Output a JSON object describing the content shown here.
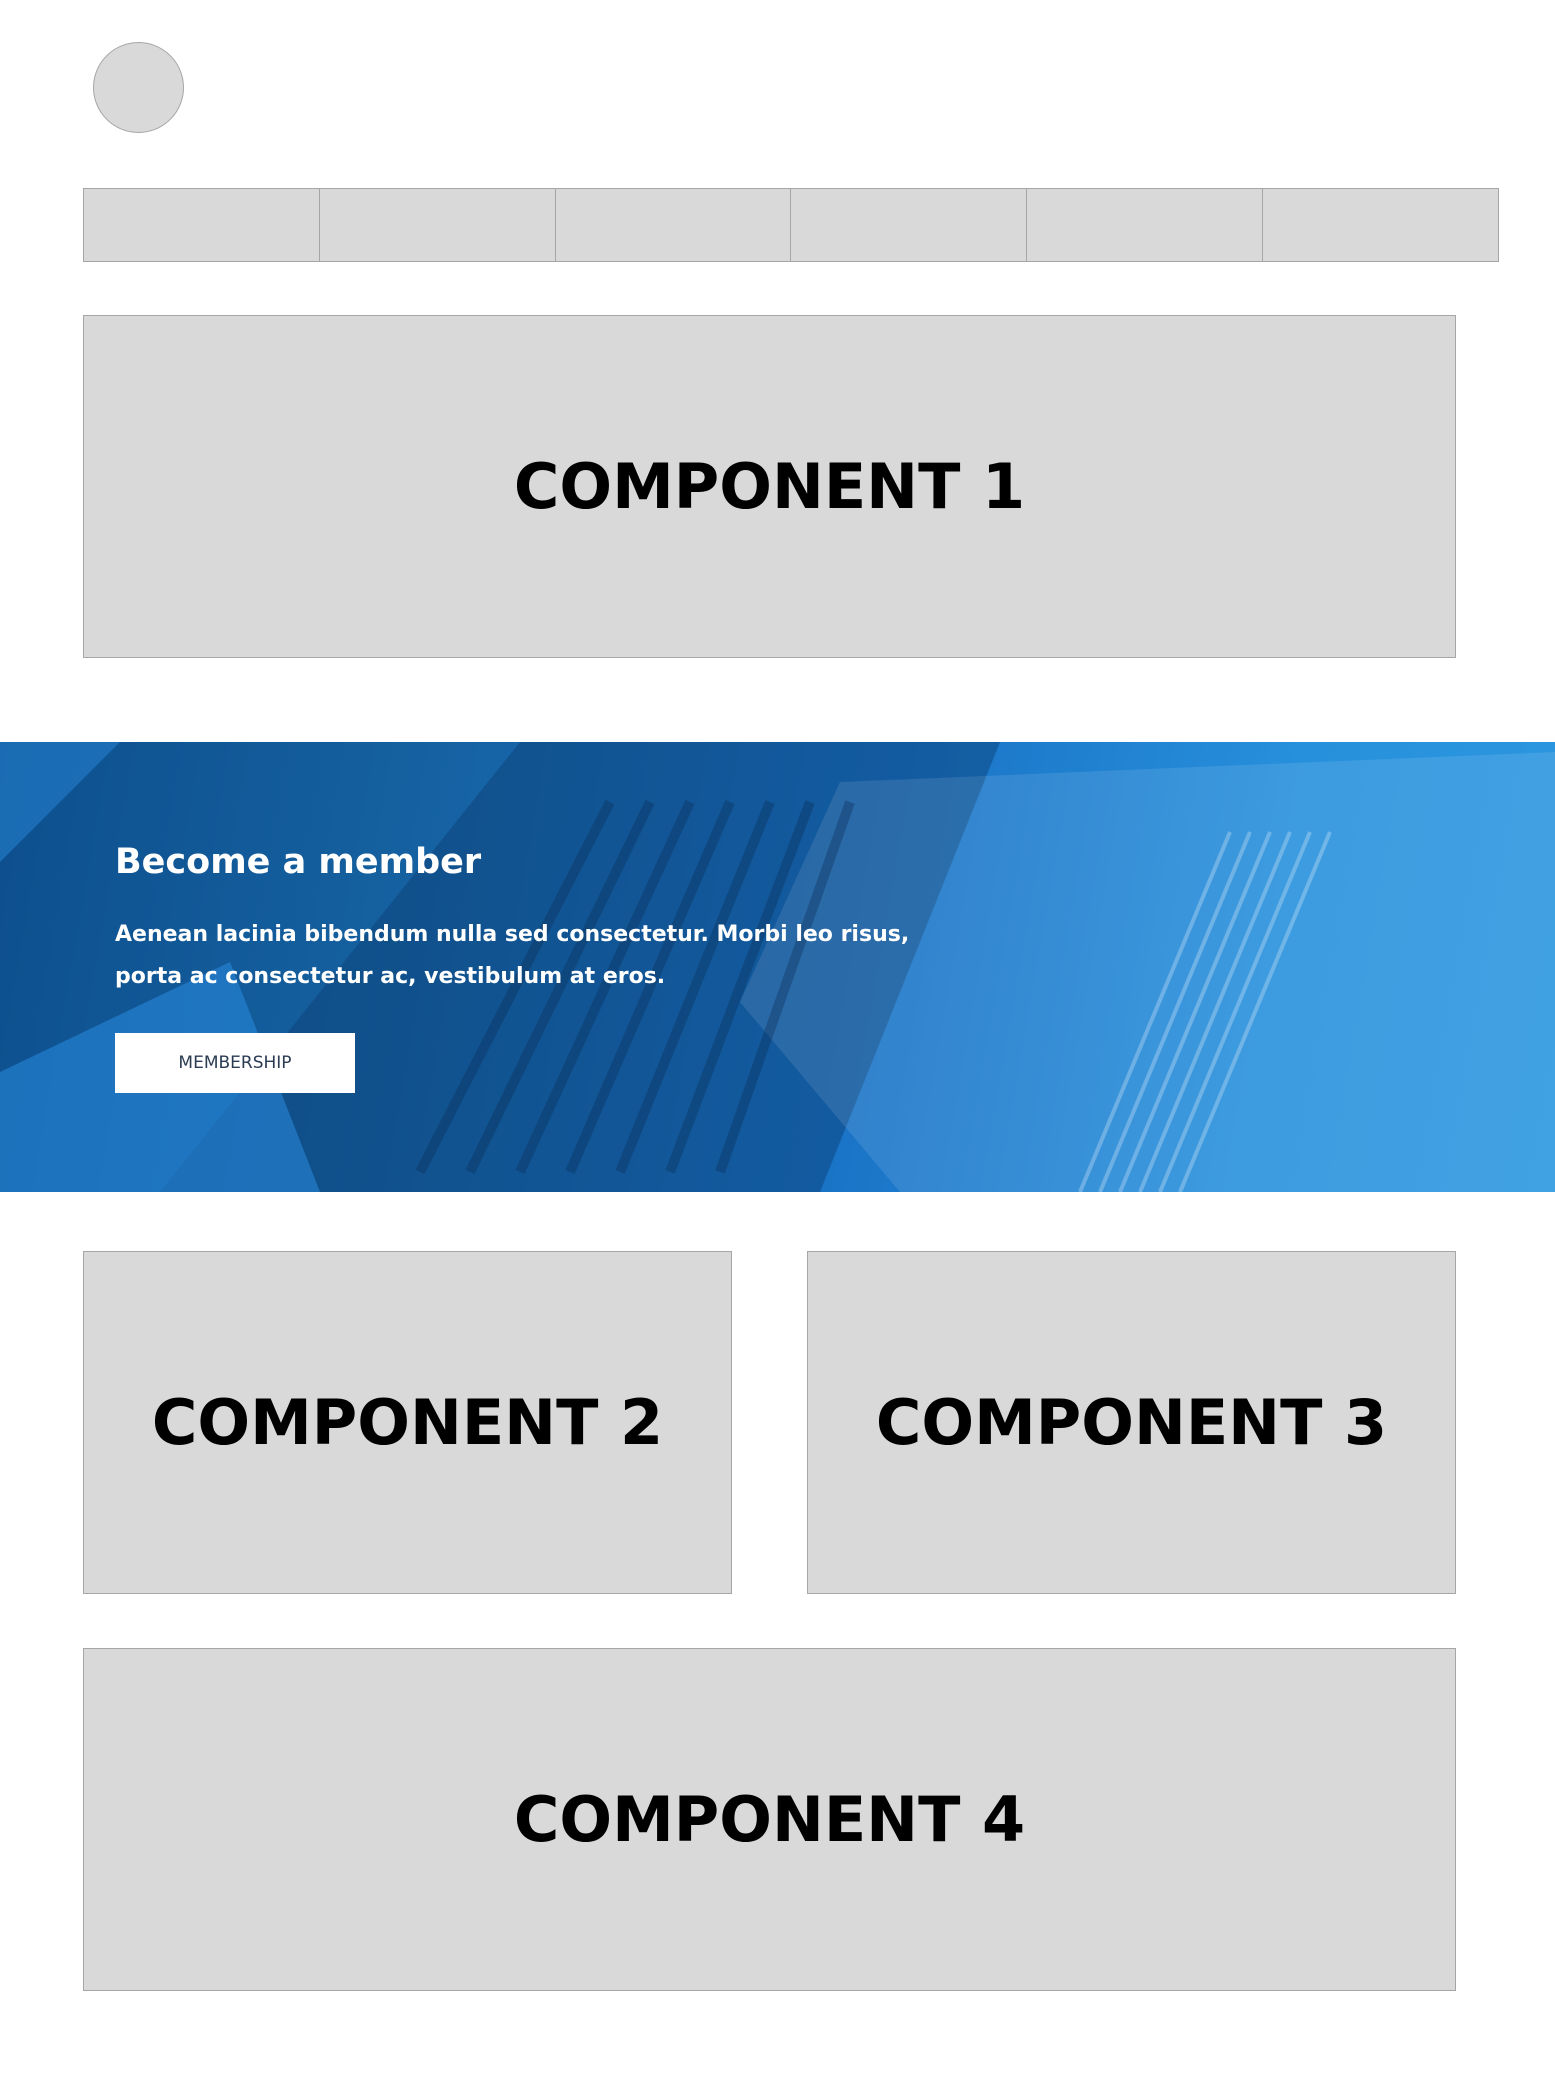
{
  "banner": {
    "title": "Become a member",
    "body": "Aenean lacinia bibendum nulla sed consectetur. Morbi leo risus, porta ac consectetur ac, vestibulum at eros.",
    "button_label": "MEMBERSHIP",
    "background_color": "#1a73c6"
  },
  "components": {
    "c1": "COMPONENT 1",
    "c2": "COMPONENT 2",
    "c3": "COMPONENT 3",
    "c4": "COMPONENT 4"
  },
  "colors": {
    "placeholder_fill": "#d9d9d9",
    "placeholder_border": "#a6a6a6",
    "text": "#000000"
  }
}
